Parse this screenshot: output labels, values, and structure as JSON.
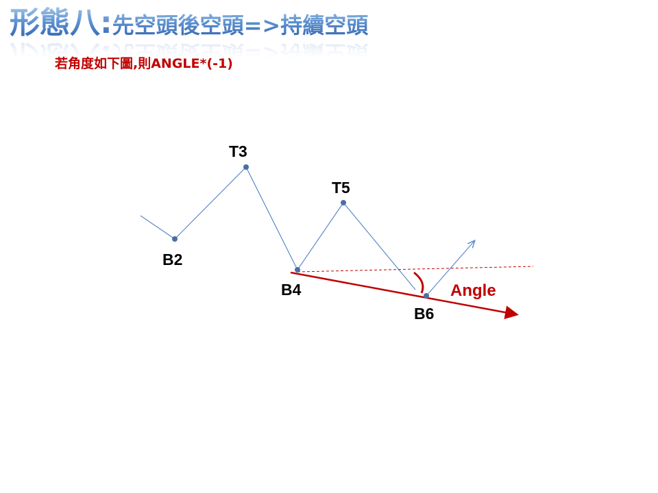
{
  "title": {
    "prefix": "形態八:",
    "main": "先空頭後空頭=>持續空頭"
  },
  "subtitle": "若角度如下圖,則ANGLE*(-1)",
  "points": {
    "b2": "B2",
    "t3": "T3",
    "b4": "B4",
    "t5": "T5",
    "b6": "B6"
  },
  "angle_label": "Angle",
  "colors": {
    "line": "#5b8bc9",
    "point": "#4a6fa5",
    "red": "#c00000",
    "title_blue": "#3a6fc0"
  }
}
